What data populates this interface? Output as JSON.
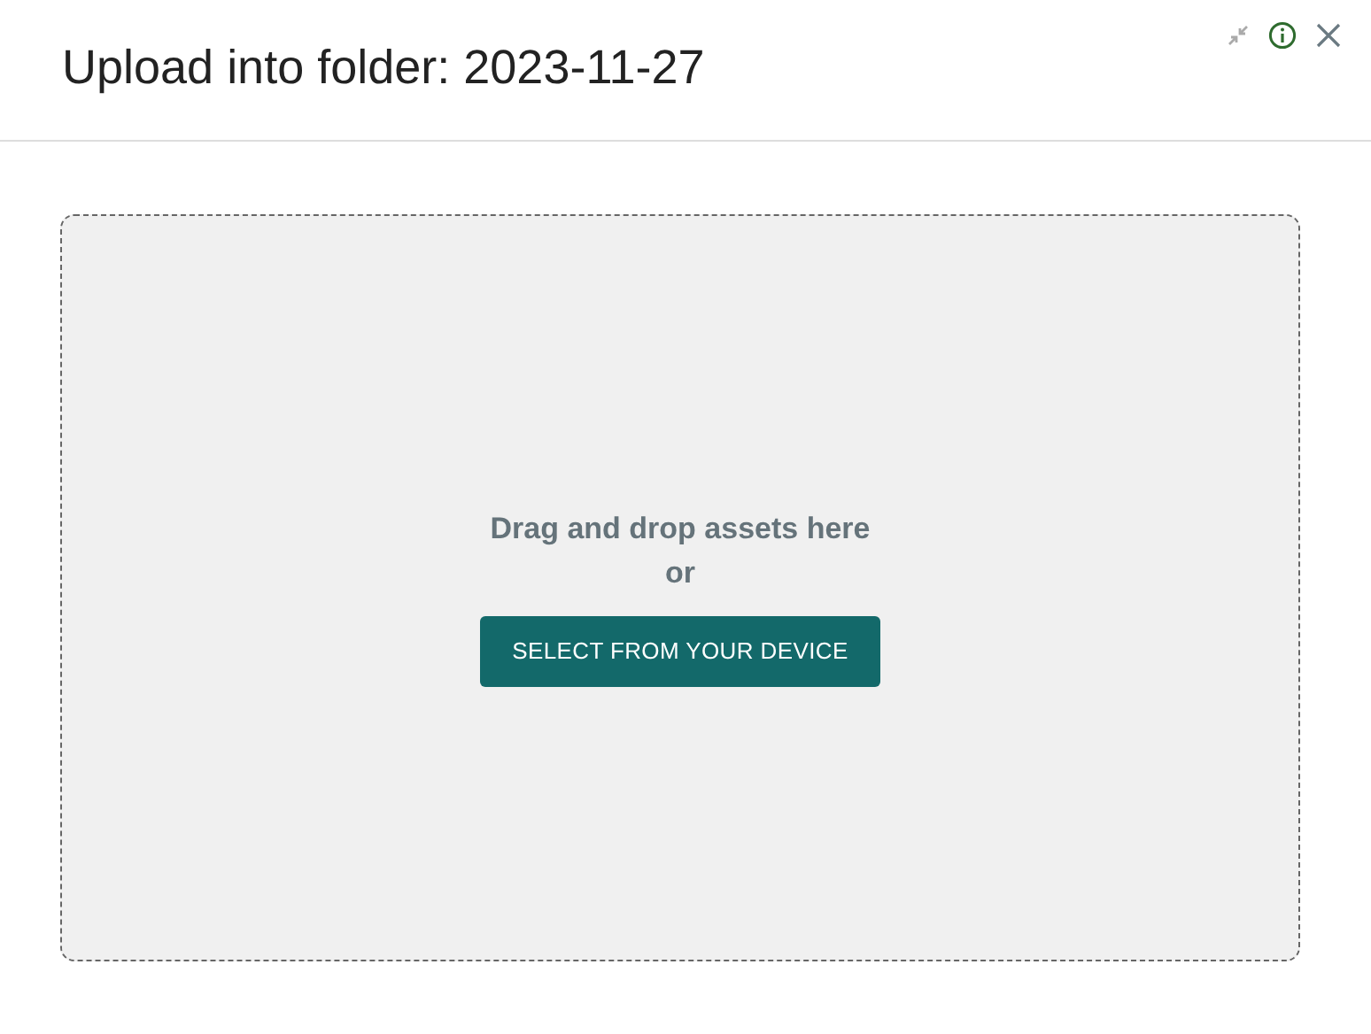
{
  "dialog": {
    "title": "Upload into folder: 2023-11-27"
  },
  "dropzone": {
    "prompt": "Drag and drop assets here",
    "separator": "or",
    "button": "SELECT FROM YOUR DEVICE"
  }
}
